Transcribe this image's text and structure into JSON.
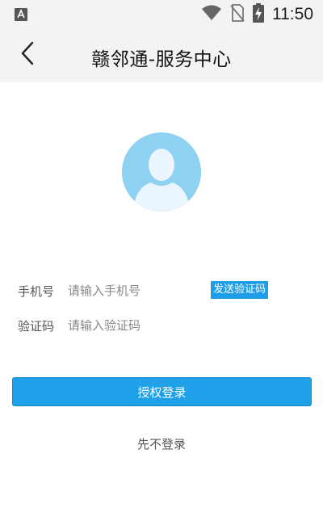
{
  "status_bar": {
    "time": "11:50",
    "icons": [
      "app-notification-icon",
      "wifi-icon",
      "no-sim-icon",
      "battery-charging-icon"
    ]
  },
  "header": {
    "back_icon": "chevron-left-icon",
    "title": "赣邻通-服务中心"
  },
  "avatar": {
    "icon": "user-avatar-icon",
    "background_color": "#8fd1f1"
  },
  "form": {
    "phone": {
      "label": "手机号",
      "placeholder": "请输入手机号",
      "value": ""
    },
    "code": {
      "label": "验证码",
      "placeholder": "请输入验证码",
      "value": ""
    },
    "send_code_label": "发送验证码"
  },
  "actions": {
    "authorize_label": "授权登录",
    "skip_label": "先不登录"
  },
  "colors": {
    "accent": "#1fa0e8",
    "header_bg": "#f3f3f3"
  }
}
